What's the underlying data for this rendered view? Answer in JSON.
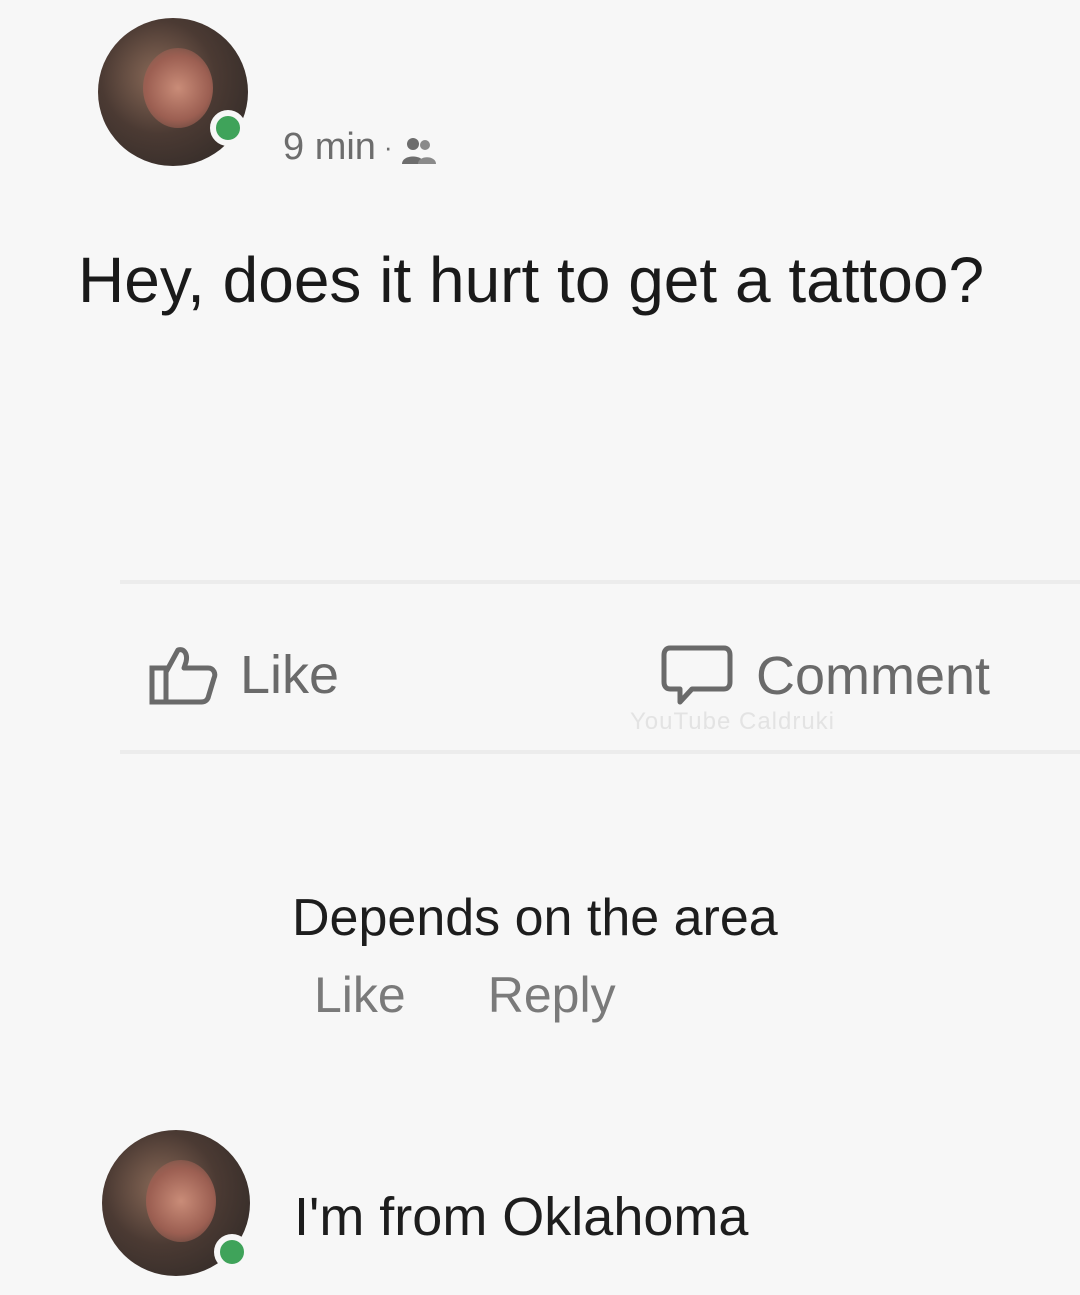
{
  "post": {
    "time": "9 min",
    "separator": "·",
    "privacy_icon": "friends-icon",
    "text": "Hey, does it hurt to get a tattoo?"
  },
  "actions": {
    "like_label": "Like",
    "comment_label": "Comment",
    "like_icon": "thumbs-up-icon",
    "comment_icon": "speech-bubble-icon"
  },
  "watermark": "YouTube Caldruki",
  "comments": [
    {
      "text": "Depends on the area",
      "like_label": "Like",
      "reply_label": "Reply"
    },
    {
      "text": "I'm from Oklahoma"
    }
  ],
  "colors": {
    "background": "#f7f7f7",
    "online": "#3fa35a",
    "secondary_text": "#6d6d6d"
  }
}
